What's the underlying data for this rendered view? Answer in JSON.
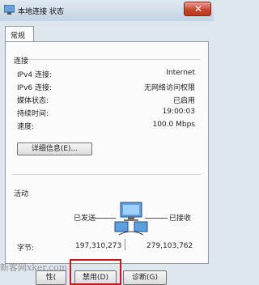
{
  "window": {
    "title": "本地连接 状态",
    "close_glyph": "✕"
  },
  "tab": {
    "label": "常规"
  },
  "connection": {
    "heading": "连接",
    "rows": [
      {
        "label": "IPv4 连接:",
        "value": "Internet"
      },
      {
        "label": "IPv6 连接:",
        "value": "无网络访问权限"
      },
      {
        "label": "媒体状态:",
        "value": "已启用"
      },
      {
        "label": "持续时间:",
        "value": "19:00:03"
      },
      {
        "label": "速度:",
        "value": "100.0 Mbps"
      }
    ],
    "details_button": "详细信息(E)..."
  },
  "activity": {
    "heading": "活动",
    "sent_label": "已发送",
    "received_label": "已接收",
    "bytes_label": "字节:",
    "bytes_sent": "197,310,273",
    "bytes_received": "279,103,762"
  },
  "buttons": {
    "partial": "性(",
    "disable": "禁用(D)",
    "diagnose": "诊断(G)"
  },
  "watermark": "新客网xker.com",
  "colors": {
    "highlight": "#c4161c",
    "close": "#c8402a"
  }
}
